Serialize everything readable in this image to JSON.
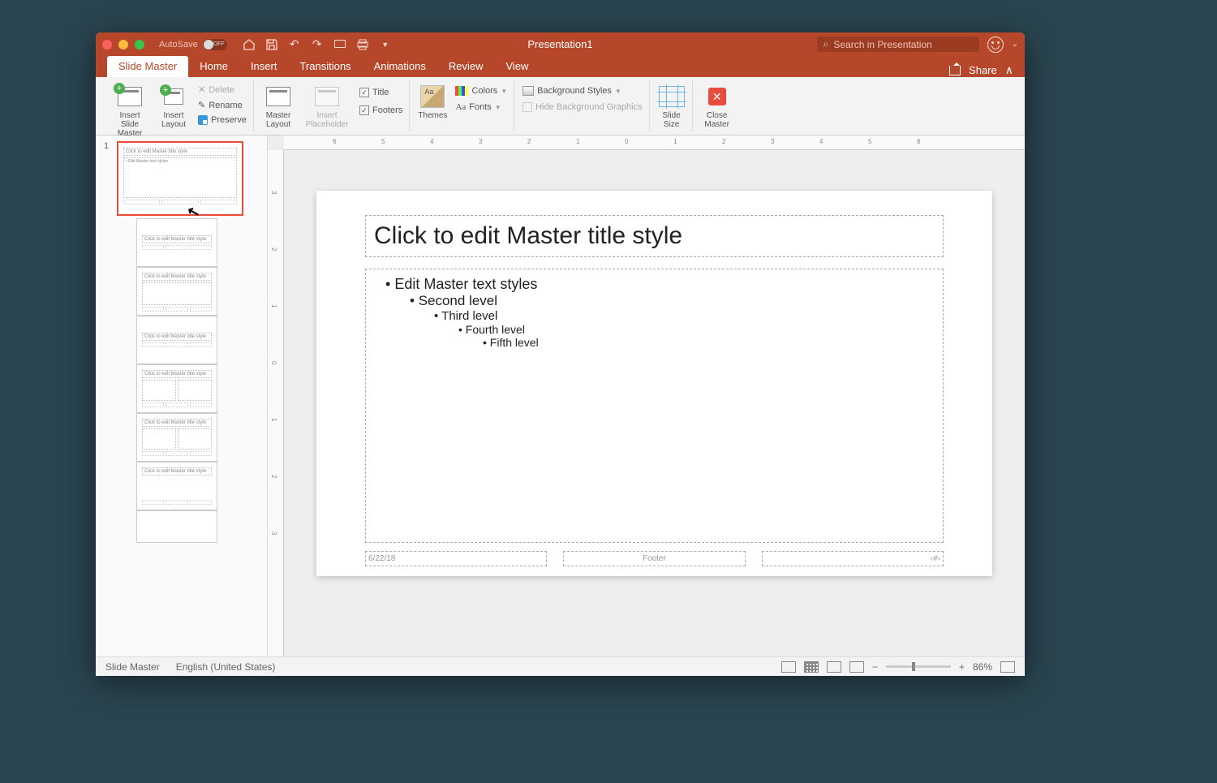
{
  "titlebar": {
    "autosave_label": "AutoSave",
    "autosave_state": "OFF",
    "title": "Presentation1",
    "search_placeholder": "Search in Presentation"
  },
  "tabs": {
    "items": [
      "Slide Master",
      "Home",
      "Insert",
      "Transitions",
      "Animations",
      "Review",
      "View"
    ],
    "active": "Slide Master",
    "share": "Share"
  },
  "ribbon": {
    "insert_master": "Insert Slide Master",
    "insert_layout": "Insert Layout",
    "delete": "Delete",
    "rename": "Rename",
    "preserve": "Preserve",
    "master_layout": "Master Layout",
    "insert_placeholder": "Insert Placeholder",
    "title_chk": "Title",
    "footers_chk": "Footers",
    "themes": "Themes",
    "colors": "Colors",
    "fonts": "Fonts",
    "bgstyles": "Background Styles",
    "hide_bg": "Hide Background Graphics",
    "slide_size": "Slide Size",
    "close_master": "Close Master"
  },
  "thumbs": {
    "master_num": "1",
    "title_text": "Click to edit Master title style",
    "body_text": "• Edit Master text styles",
    "layout_title": "Click to edit Master title style"
  },
  "slide": {
    "title": "Click to edit Master title style",
    "lvl1": "Edit Master text styles",
    "lvl2": "Second level",
    "lvl3": "Third level",
    "lvl4": "Fourth level",
    "lvl5": "Fifth level",
    "date": "6/22/18",
    "footer": "Footer",
    "pagenum": "‹#›"
  },
  "status": {
    "view": "Slide Master",
    "lang": "English (United States)",
    "zoom": "86%"
  },
  "ruler_h": [
    -6,
    -5,
    -4,
    -3,
    -2,
    -1,
    0,
    1,
    2,
    3,
    4,
    5,
    6
  ],
  "ruler_v": [
    -3,
    -2,
    -1,
    0,
    1,
    2,
    3
  ]
}
